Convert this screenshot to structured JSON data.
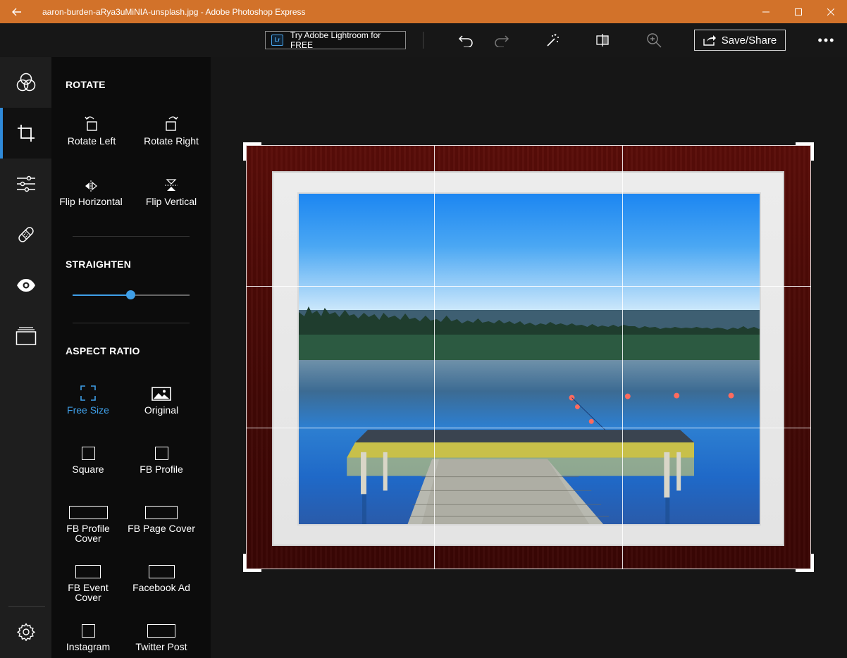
{
  "titlebar": {
    "title": "aaron-burden-aRya3uMiNIA-unsplash.jpg - Adobe Photoshop Express",
    "back_icon": "arrow-left-icon",
    "accent": "#d2722a"
  },
  "toolbar": {
    "lightroom_badge": "Lr",
    "lightroom_label": "Try Adobe Lightroom for FREE",
    "save_label": "Save/Share",
    "more_label": "•••",
    "icons": [
      "undo-icon",
      "redo-icon",
      "magic-wand-icon",
      "compare-icon",
      "zoom-icon",
      "share-icon"
    ]
  },
  "rail": {
    "items": [
      "looks-icon",
      "crop-icon",
      "adjust-icon",
      "heal-icon",
      "eye-icon",
      "layers-icon"
    ],
    "active": "crop-icon",
    "settings": "gear-icon"
  },
  "panel": {
    "rotate": {
      "title": "ROTATE",
      "left": "Rotate Left",
      "right": "Rotate Right",
      "flip_h": "Flip Horizontal",
      "flip_v": "Flip Vertical"
    },
    "straighten": {
      "title": "STRAIGHTEN",
      "value_fraction": 0.5
    },
    "aspect": {
      "title": "ASPECT RATIO",
      "free": "Free Size",
      "original": "Original",
      "square": "Square",
      "fb_profile": "FB Profile",
      "fb_profile_cover_1": "FB Profile",
      "fb_profile_cover_2": "Cover",
      "fb_page_cover": "FB Page Cover",
      "fb_event_cover_1": "FB Event",
      "fb_event_cover_2": "Cover",
      "facebook_ad": "Facebook Ad",
      "instagram": "Instagram",
      "twitter_post": "Twitter Post",
      "selected": "Free Size"
    }
  },
  "colors": {
    "accent_blue": "#3f9fe8",
    "frame_wood": "#4a0a06"
  }
}
